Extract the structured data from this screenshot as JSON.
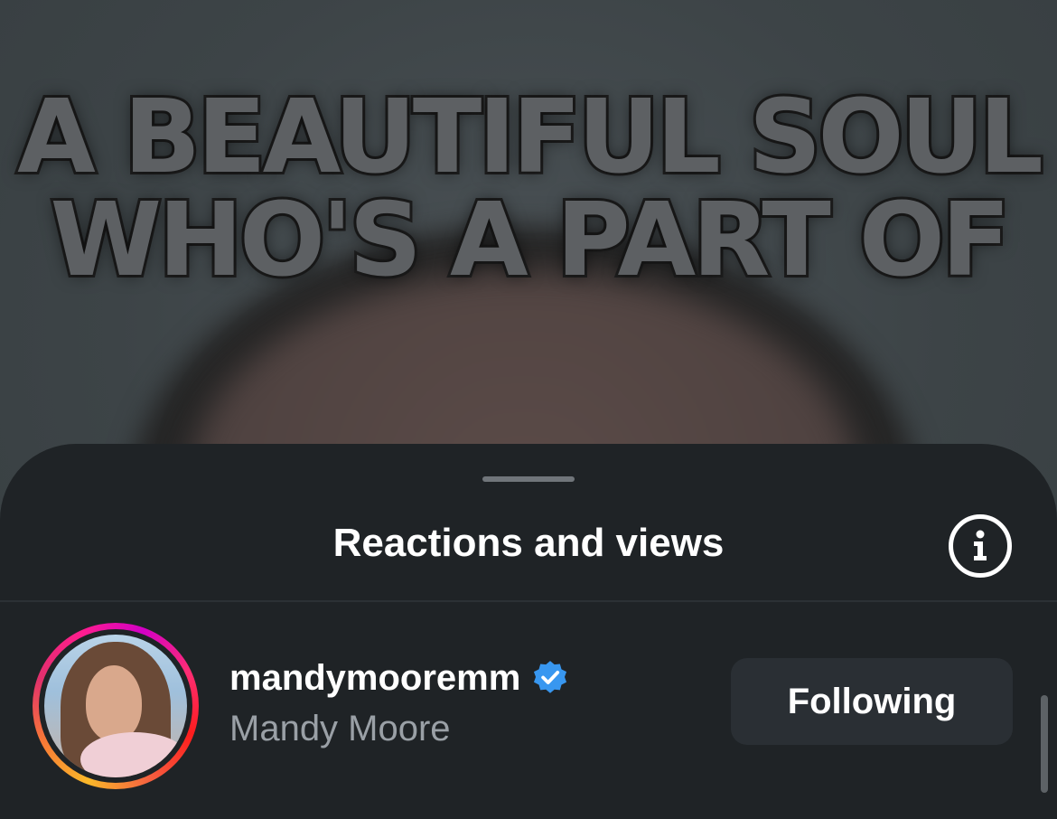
{
  "story": {
    "caption_line1": "A BEAUTIFUL SOUL",
    "caption_line2": "WHO'S A PART OF"
  },
  "sheet": {
    "title": "Reactions and views",
    "info_icon": "info-icon"
  },
  "viewers": [
    {
      "username": "mandymooremm",
      "verified": true,
      "full_name": "Mandy Moore",
      "follow_label": "Following",
      "story_ring": true
    }
  ],
  "colors": {
    "sheet_bg": "#1f2326",
    "verified_blue": "#3897f0",
    "secondary_text": "#9aa0a6",
    "button_bg": "#2a2f34"
  }
}
